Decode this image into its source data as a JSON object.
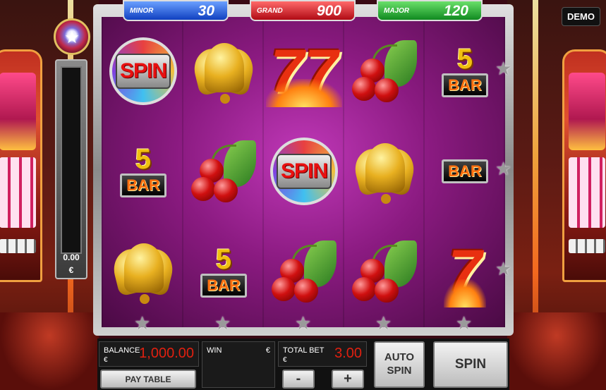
{
  "jackpots": {
    "minor": {
      "label": "MINOR",
      "amount": "30"
    },
    "grand": {
      "label": "GRAND",
      "amount": "900"
    },
    "major": {
      "label": "MAJOR",
      "amount": "120"
    }
  },
  "demo_label": "DEMO",
  "meter": {
    "value": "0.00",
    "currency": "€"
  },
  "reels": [
    [
      "spin",
      "bar5",
      "bell"
    ],
    [
      "bell",
      "cherry",
      "bar5"
    ],
    [
      "seven_double",
      "spin",
      "cherry"
    ],
    [
      "cherry",
      "bell",
      "cherry"
    ],
    [
      "bar5",
      "bar",
      "seven"
    ]
  ],
  "symbol_text": {
    "spin": "SPIN",
    "bar": "BAR",
    "five": "5",
    "seven": "7",
    "seven_double": "77"
  },
  "panel": {
    "balance_label": "BALANCE",
    "balance_currency": "€",
    "balance_value": "1,000.00",
    "win_label": "WIN",
    "win_currency": "€",
    "total_bet_label": "TOTAL BET",
    "total_bet_currency": "€",
    "total_bet_value": "3.00",
    "paytable_label": "PAY TABLE",
    "minus_label": "-",
    "plus_label": "+",
    "auto_spin_label_1": "AUTO",
    "auto_spin_label_2": "SPIN",
    "spin_label": "SPIN"
  },
  "colors": {
    "accent_red": "#e02010",
    "reel_bg": "#8a1a80"
  }
}
